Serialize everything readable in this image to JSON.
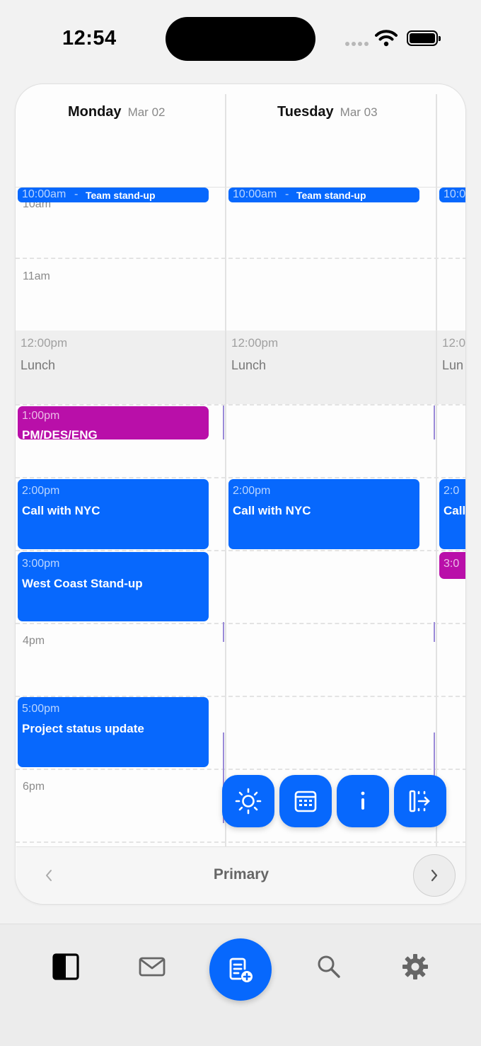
{
  "status_bar": {
    "time": "12:54"
  },
  "calendar": {
    "days": [
      {
        "name": "Monday",
        "date": "Mar 02"
      },
      {
        "name": "Tuesday",
        "date": "Mar 03"
      }
    ],
    "hour_labels": {
      "h10": "10am",
      "h11": "11am",
      "h4": "4pm",
      "h6": "6pm"
    },
    "standup": {
      "time": "10:00am",
      "sep": "-",
      "title": "Team stand-up",
      "partial_time": "10:0"
    },
    "lunch": {
      "time": "12:00pm",
      "title": "Lunch",
      "partial_time": "12:0",
      "partial_title": "Lun"
    },
    "events": {
      "pm_des_eng": {
        "time": "1:00pm",
        "title": "PM/DES/ENG"
      },
      "call_nyc": {
        "time": "2:00pm",
        "title": "Call with NYC",
        "partial_time": "2:0",
        "partial_title": "Call"
      },
      "west_coast": {
        "time": "3:00pm",
        "title": "West Coast Stand-up",
        "partial_time": "3:0"
      },
      "project_status": {
        "time": "5:00pm",
        "title": "Project status update"
      }
    }
  },
  "toolbar": {
    "icons": [
      "sun-icon",
      "calendar-icon",
      "more-vertical-icon",
      "exit-panel-icon"
    ]
  },
  "pager": {
    "label": "Primary"
  },
  "tabbar": {
    "icons": [
      "sidebar-panel-icon",
      "mail-icon",
      "compose-icon",
      "search-icon",
      "settings-icon"
    ]
  },
  "colors": {
    "accent": "#0768fd",
    "magenta": "#b90fa9"
  }
}
